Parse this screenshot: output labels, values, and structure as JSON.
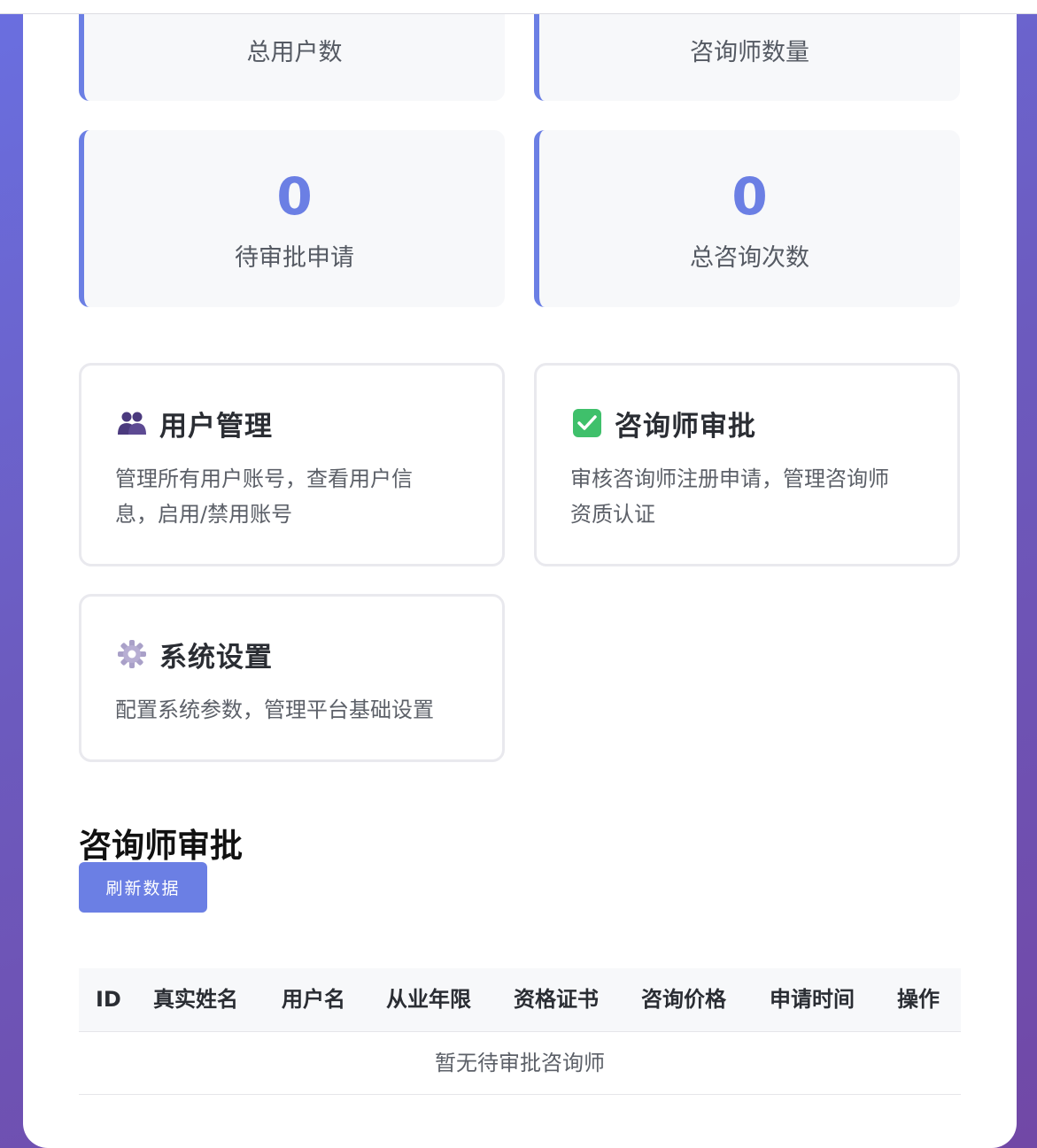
{
  "stats": [
    {
      "value": "",
      "label": "总用户数"
    },
    {
      "value": "",
      "label": "咨询师数量"
    },
    {
      "value": "0",
      "label": "待审批申请"
    },
    {
      "value": "0",
      "label": "总咨询次数"
    }
  ],
  "cards": [
    {
      "icon": "users-icon",
      "title": "用户管理",
      "desc": "管理所有用户账号，查看用户信息，启用/禁用账号"
    },
    {
      "icon": "checkmark-icon",
      "title": "咨询师审批",
      "desc": "审核咨询师注册申请，管理咨询师资质认证"
    },
    {
      "icon": "gear-icon",
      "title": "系统设置",
      "desc": "配置系统参数，管理平台基础设置"
    }
  ],
  "approval": {
    "title": "咨询师审批",
    "refresh_label": "刷新数据",
    "columns": [
      "ID",
      "真实姓名",
      "用户名",
      "从业年限",
      "资格证书",
      "咨询价格",
      "申请时间",
      "操作"
    ],
    "empty_text": "暂无待审批咨询师"
  },
  "colors": {
    "accent": "#6b7fe4",
    "card_border": "#e9e9ee",
    "stat_bg": "#f7f8fa"
  }
}
